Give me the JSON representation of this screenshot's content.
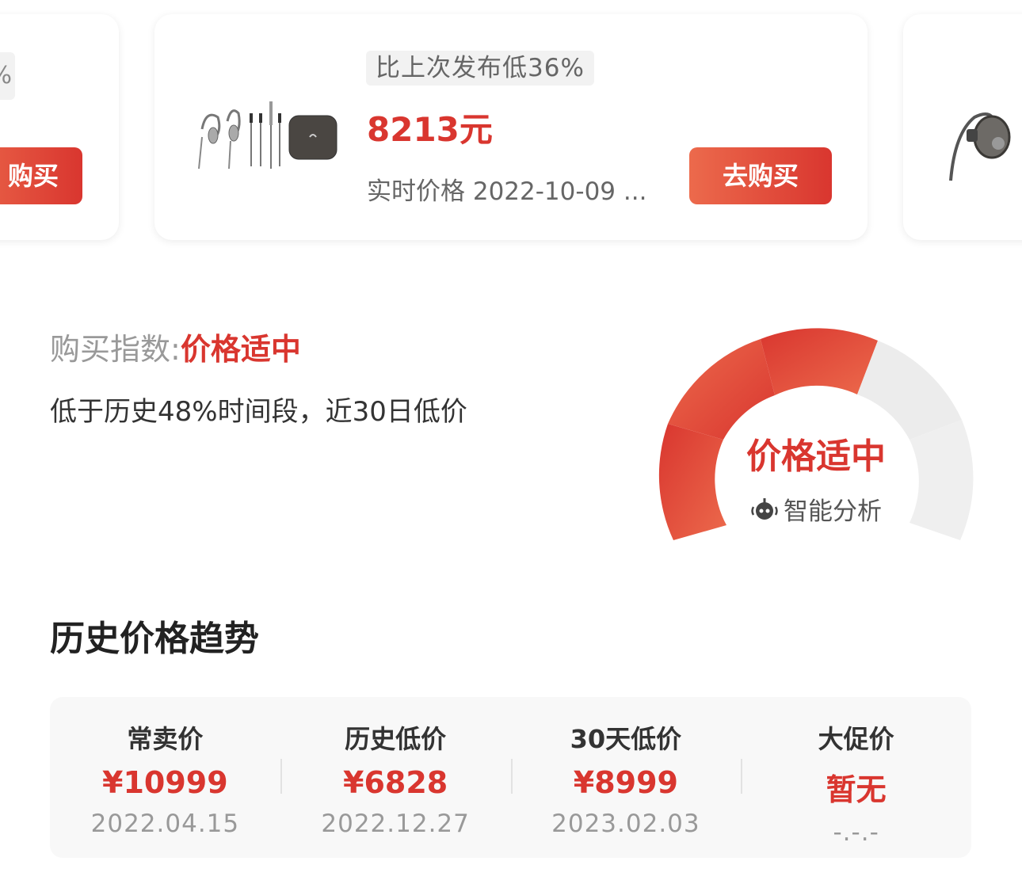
{
  "carousel": {
    "left_card": {
      "tag_fragment": "%",
      "buy_label": "购买"
    },
    "main_card": {
      "discount_tag": "比上次发布低36%",
      "price": "8213元",
      "realtime": "实时价格 2022-10-09 ...",
      "buy_label": "去购买"
    }
  },
  "buy_index": {
    "label": "购买指数:",
    "value": "价格适中",
    "description": "低于历史48%时间段，近30日低价"
  },
  "gauge": {
    "label": "价格适中",
    "sub_label": "智能分析",
    "icon": "robot-icon",
    "level": "价格适中",
    "colors": {
      "active": "#d9362f",
      "active_light": "#ec6a4c",
      "inactive": "#ececec"
    }
  },
  "history": {
    "title": "历史价格趋势",
    "stats": [
      {
        "label": "常卖价",
        "value": "¥10999",
        "date": "2022.04.15"
      },
      {
        "label": "历史低价",
        "value": "¥6828",
        "date": "2022.12.27"
      },
      {
        "label": "30天低价",
        "value": "¥8999",
        "date": "2023.02.03"
      },
      {
        "label": "大促价",
        "value": "暂无",
        "date": "-.-.-"
      }
    ]
  }
}
